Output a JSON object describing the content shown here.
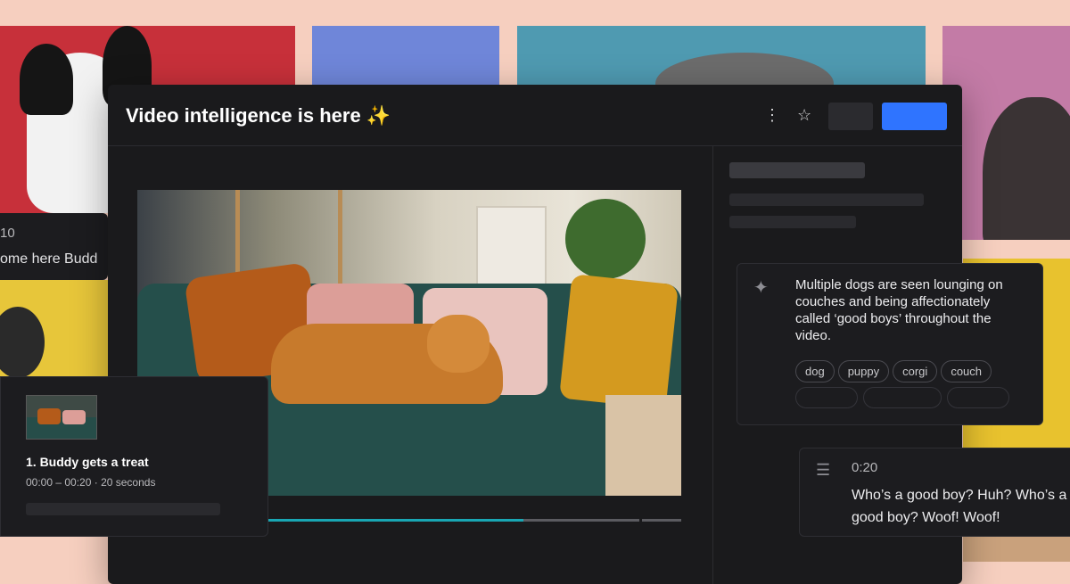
{
  "window": {
    "title": "Video intelligence is here",
    "title_emoji": "✨"
  },
  "summary": {
    "text": "Multiple dogs are seen lounging on couches and being affectionately called ‘good boys’ throughout the video.",
    "tags": [
      "dog",
      "puppy",
      "corgi",
      "couch"
    ]
  },
  "transcript": {
    "timestamp": "0:20",
    "text": "Who’s a good boy? Huh? Who’s a good boy? Woof! Woof!"
  },
  "chapter": {
    "title": "1. Buddy gets a treat",
    "meta": "00:00 – 00:20 · 20 seconds"
  },
  "left_partial": {
    "timestamp": "10",
    "text": "ome here Budd"
  },
  "playback": {
    "progress": 0.62
  },
  "colors": {
    "accent": "#2f74ff",
    "progress": "#19a6b3"
  }
}
